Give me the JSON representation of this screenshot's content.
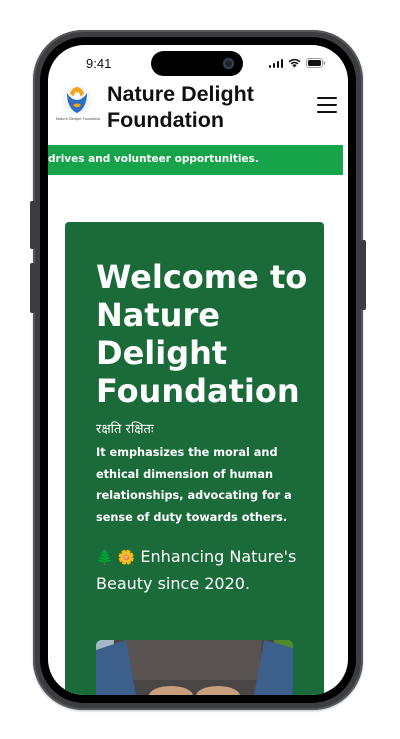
{
  "status_bar": {
    "time": "9:41"
  },
  "header": {
    "logo_tagline": "Nature Delight Foundation",
    "title": "Nature Delight Foundation",
    "menu_icon": "hamburger-menu-icon"
  },
  "ticker": {
    "text": "drives and volunteer opportunities."
  },
  "hero": {
    "title": "Welcome to Nature Delight Foundation",
    "motto": "रक्षति रक्षितः",
    "description": "It emphasizes the moral and ethical dimension of human relationships, advocating for a sense of duty towards others.",
    "tagline_emoji": "🌲 🌼",
    "tagline": "Enhancing Nature's Beauty since 2020."
  },
  "colors": {
    "ticker_bg": "#16a34a",
    "hero_bg": "#1b6b3a",
    "phone_frame": "#3b3d40"
  }
}
